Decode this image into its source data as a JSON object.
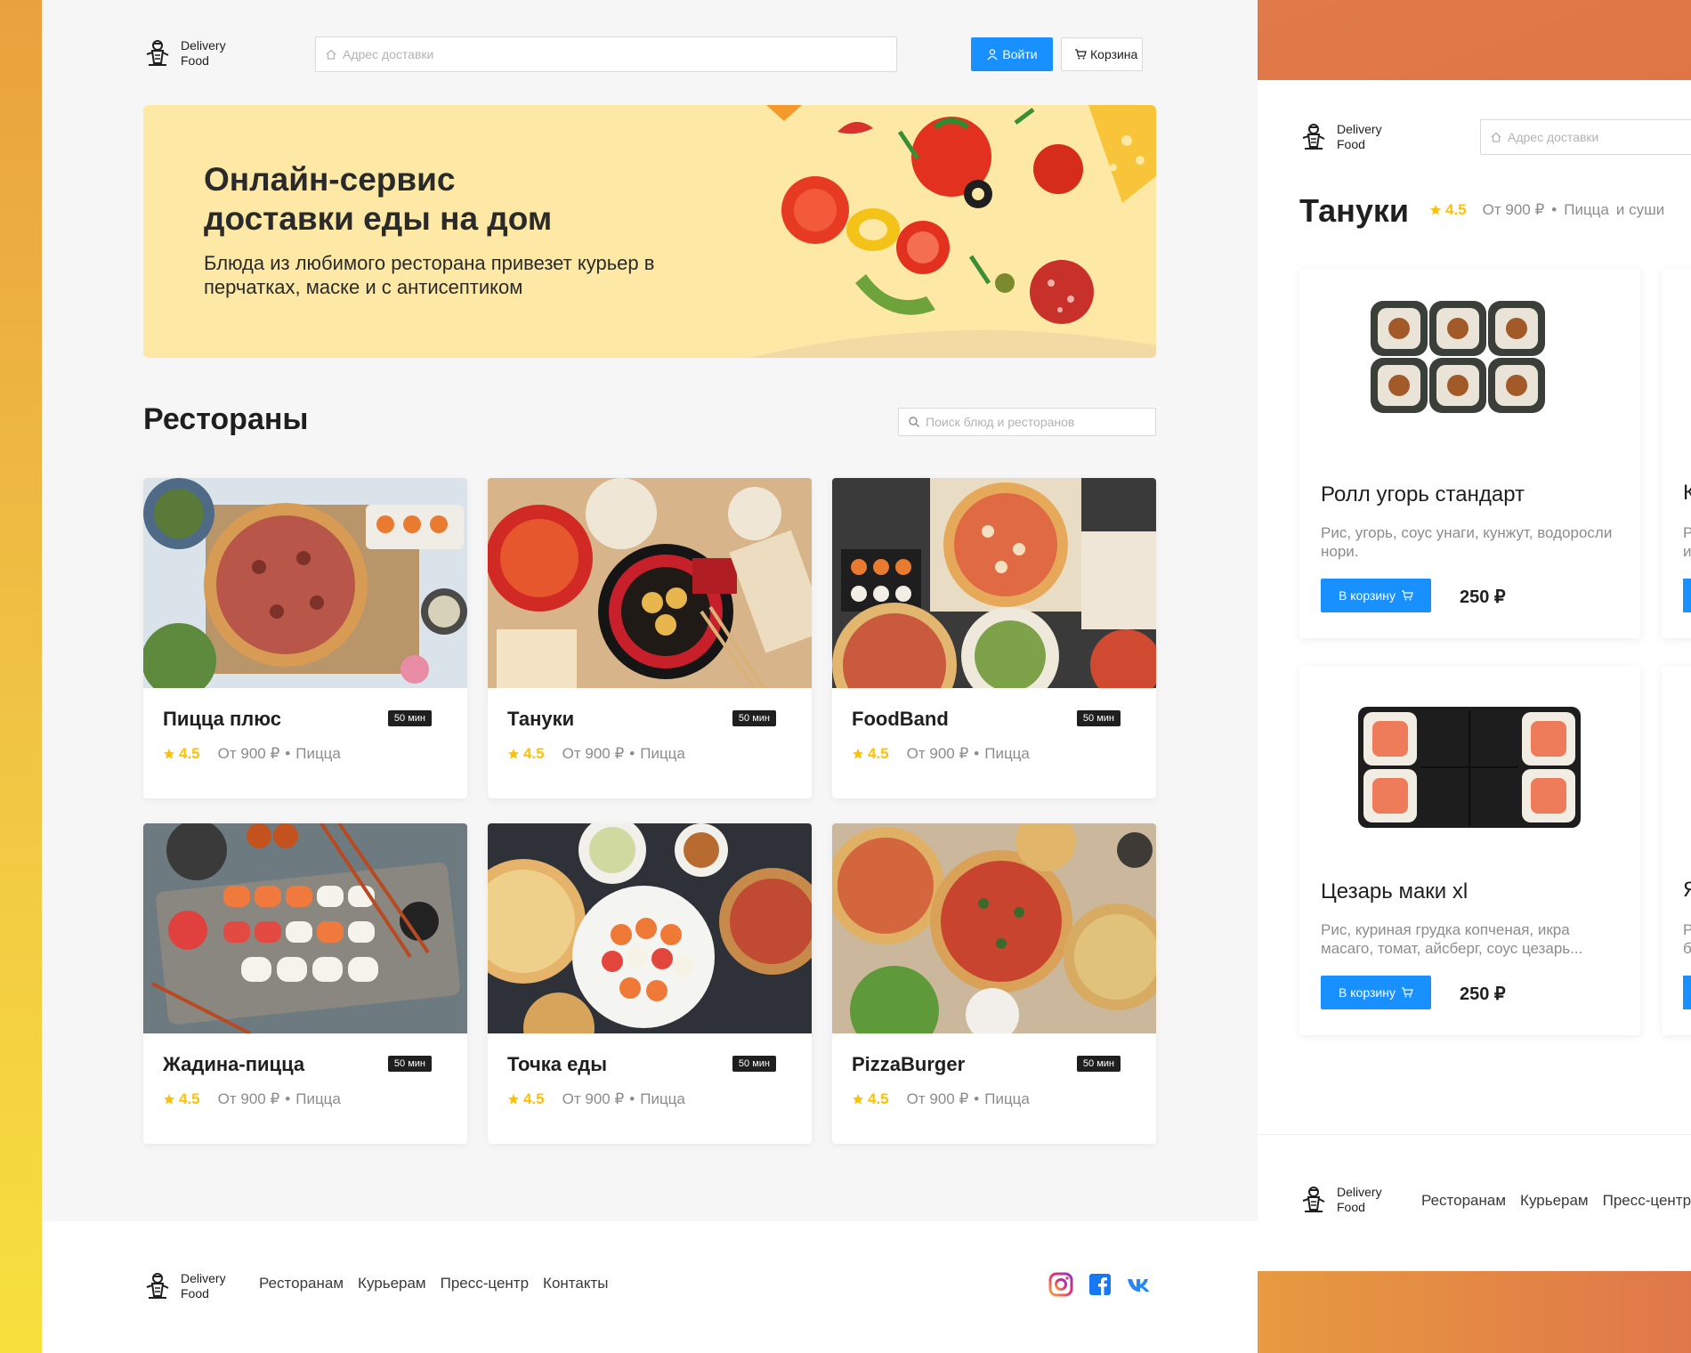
{
  "brand": {
    "line1": "Delivery",
    "line2": "Food"
  },
  "header": {
    "address_placeholder": "Адрес доставки",
    "login_label": "Войти",
    "cart_label": "Корзина"
  },
  "promo": {
    "title": "Онлайн-сервис доставки еды на дом",
    "text": "Блюда из любимого ресторана привезет курьер в перчатках, маске и с антисептиком"
  },
  "restaurants_section": {
    "title": "Рестораны",
    "search_placeholder": "Поиск блюд и ресторанов"
  },
  "restaurants": [
    {
      "name": "Пицца плюс",
      "time": "50 мин",
      "rating": "4.5",
      "price": "От 900 ₽",
      "category": "Пицца",
      "image": "pizza-table"
    },
    {
      "name": "Тануки",
      "time": "50 мин",
      "rating": "4.5",
      "price": "От 900 ₽",
      "category": "Пицца",
      "image": "asian-table"
    },
    {
      "name": "FoodBand",
      "time": "50 мин",
      "rating": "4.5",
      "price": "От 900 ₽",
      "category": "Пицца",
      "image": "pizza-boxes"
    },
    {
      "name": "Жадина-пицца",
      "time": "50 мин",
      "rating": "4.5",
      "price": "От 900 ₽",
      "category": "Пицца",
      "image": "sushi-board"
    },
    {
      "name": "Точка еды",
      "time": "50 мин",
      "rating": "4.5",
      "price": "От 900 ₽",
      "category": "Пицца",
      "image": "dark-table"
    },
    {
      "name": "PizzaBurger",
      "time": "50 мин",
      "rating": "4.5",
      "price": "От 900 ₽",
      "category": "Пицца",
      "image": "pizza-wood"
    }
  ],
  "footer": {
    "nav": [
      "Ресторанам",
      "Курьерам",
      "Пресс-центр",
      "Контакты"
    ],
    "social": [
      "instagram-icon",
      "facebook-icon",
      "vk-icon"
    ]
  },
  "restaurant_page": {
    "address_placeholder": "Адрес доставки",
    "title": "Тануки",
    "rating": "4.5",
    "price": "От 900 ₽",
    "category": "Пицца",
    "category_extra": "и суши",
    "dishes": [
      {
        "name": "Ролл угорь стандарт",
        "desc": "Рис, угорь, соус унаги, кунжут, водоросли нори.",
        "button": "В корзину",
        "price": "250 ₽",
        "image": "eel-roll"
      },
      {
        "name": "Цезарь маки xl",
        "desc": "Рис, куриная грудка копченая, икра масаго, томат, айсберг, соус цезарь...",
        "button": "В корзину",
        "price": "250 ₽",
        "image": "caesar-maki"
      }
    ],
    "peek": [
      {
        "letter": "К",
        "desc": "Р\nи"
      },
      {
        "letter": "Я",
        "desc": "Р\nб"
      }
    ],
    "footer_nav": [
      "Ресторанам",
      "Курьерам",
      "Пресс-центр"
    ]
  },
  "colors": {
    "accent": "#1890ff",
    "promo_bg": "#fde9a5",
    "rating": "#ffc107",
    "badge": "#1f1f1f"
  }
}
